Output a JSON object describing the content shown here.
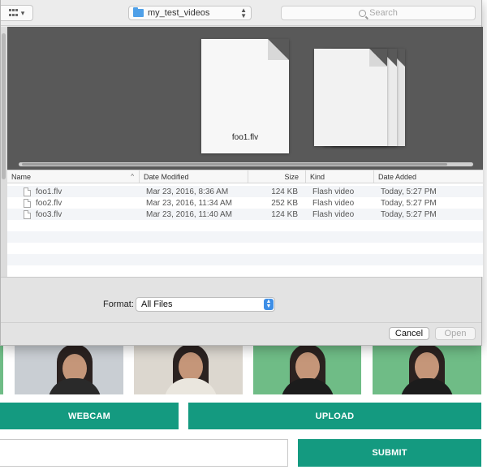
{
  "dialog": {
    "toolbar": {
      "view_icon": "icon-grid-view",
      "view_chevron": "▾",
      "folder_name": "my_test_videos",
      "search_placeholder": "Search"
    },
    "preview": {
      "selected_file_label": "foo1.flv"
    },
    "list": {
      "columns": [
        "Name",
        "Date Modified",
        "Size",
        "Kind",
        "Date Added"
      ],
      "sort_indicator": "^",
      "rows": [
        {
          "name": "foo1.flv",
          "date_modified": "Mar 23, 2016, 8:36 AM",
          "size": "124 KB",
          "kind": "Flash video",
          "date_added": "Today, 5:27 PM"
        },
        {
          "name": "foo2.flv",
          "date_modified": "Mar 23, 2016, 11:34 AM",
          "size": "252 KB",
          "kind": "Flash video",
          "date_added": "Today, 5:27 PM"
        },
        {
          "name": "foo3.flv",
          "date_modified": "Mar 23, 2016, 11:40 AM",
          "size": "124 KB",
          "kind": "Flash video",
          "date_added": "Today, 5:27 PM"
        }
      ]
    },
    "format": {
      "label": "Format:",
      "selected": "All Files"
    },
    "buttons": {
      "cancel": "Cancel",
      "open": "Open"
    }
  },
  "page": {
    "webcam_label": "WEBCAM",
    "upload_label": "UPLOAD",
    "submit_label": "SUBMIT",
    "colors": {
      "accent": "#149a80",
      "thumb_green": "#6fbc86",
      "preview_bg": "#595959",
      "select_blue": "#3d8ee6"
    }
  }
}
